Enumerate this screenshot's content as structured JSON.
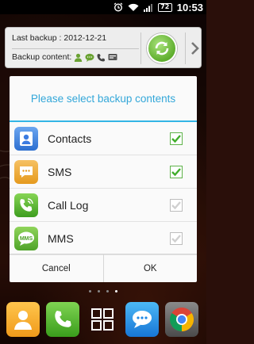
{
  "status_bar": {
    "battery": "72",
    "time": "10:53",
    "icons": [
      "alarm-icon",
      "wifi-icon",
      "signal-icon",
      "battery-icon"
    ]
  },
  "widget": {
    "last_backup": "Last backup : 2012-12-21",
    "backup_content_label": "Backup content:",
    "content_icons": [
      "contacts-icon",
      "sms-icon",
      "call-icon",
      "mms-icon"
    ],
    "action_icon": "sync-icon",
    "more_icon": "chevron-right-icon"
  },
  "dialog": {
    "title": "Please select backup contents",
    "items": [
      {
        "label": "Contacts",
        "icon": "contacts-icon",
        "checked": true
      },
      {
        "label": "SMS",
        "icon": "sms-icon",
        "checked": true
      },
      {
        "label": "Call Log",
        "icon": "call-log-icon",
        "checked": false
      },
      {
        "label": "MMS",
        "icon": "mms-icon",
        "checked": false
      }
    ],
    "cancel_label": "Cancel",
    "ok_label": "OK"
  },
  "page_indicator": {
    "count": 4,
    "active_index": 3
  },
  "dock": {
    "apps": [
      "contacts-app-icon",
      "phone-app-icon",
      "app-drawer-icon",
      "messaging-app-icon",
      "chrome-app-icon"
    ]
  },
  "colors": {
    "accent": "#33b5e5",
    "title_text": "#33a7d9",
    "check_green": "#5fb34a"
  }
}
